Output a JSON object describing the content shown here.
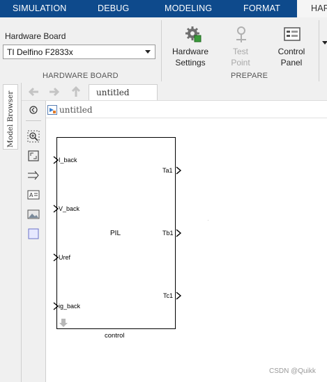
{
  "tabs": [
    {
      "label": "SIMULATION",
      "active": false
    },
    {
      "label": "DEBUG",
      "active": false
    },
    {
      "label": "MODELING",
      "active": false
    },
    {
      "label": "FORMAT",
      "active": false
    },
    {
      "label": "HAR",
      "active": true
    }
  ],
  "hardware_board": {
    "field_label": "Hardware Board",
    "selected": "TI Delfino F2833x",
    "section_label": "HARDWARE BOARD"
  },
  "prepare": {
    "section_label": "PREPARE",
    "buttons": [
      {
        "label": "Hardware\nSettings",
        "icon": "gear-chip-icon",
        "enabled": true
      },
      {
        "label": "Test\nPoint",
        "icon": "test-point-icon",
        "enabled": false
      },
      {
        "label": "Control\nPanel",
        "icon": "control-panel-icon",
        "enabled": true
      }
    ]
  },
  "model_browser": {
    "label": "Model Browser"
  },
  "model_tab": {
    "label": "untitled"
  },
  "breadcrumb": {
    "label": "untitled"
  },
  "block": {
    "center_label": "PIL",
    "name": "control",
    "inputs": [
      "I_back",
      "V_back",
      "Uref",
      "ig_back"
    ],
    "outputs": [
      "Ta1",
      "Tb1",
      "Tc1"
    ]
  },
  "watermark": "CSDN @Quikk",
  "colors": {
    "tabbar": "#0e4a8c",
    "ribbon": "#f0f0f0"
  }
}
